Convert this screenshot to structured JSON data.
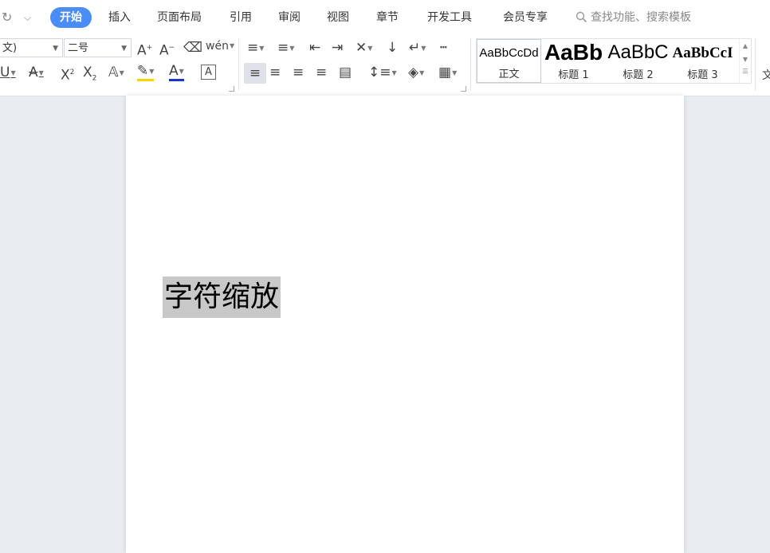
{
  "menubar": {
    "tabs": [
      {
        "label": "开始",
        "active": true
      },
      {
        "label": "插入"
      },
      {
        "label": "页面布局"
      },
      {
        "label": "引用"
      },
      {
        "label": "审阅"
      },
      {
        "label": "视图"
      },
      {
        "label": "章节"
      },
      {
        "label": "开发工具"
      },
      {
        "label": "会员专享"
      }
    ],
    "search_label": "查找功能、搜索模板"
  },
  "ribbon": {
    "font_name": "文)",
    "font_size": "二号",
    "styles": [
      {
        "sample": "AaBbCcDd",
        "label": "正文"
      },
      {
        "sample": "AaBb",
        "label": "标题 1"
      },
      {
        "sample": "AaBbC",
        "label": "标题 2"
      },
      {
        "sample": "AaBbCcI",
        "label": "标题 3"
      }
    ],
    "edge_glyph": "文"
  },
  "document": {
    "selected_text": "字符缩放"
  },
  "colors": {
    "accent": "#4a8df8",
    "selection": "#c8c8c8",
    "highlight": "#f5d800",
    "font_color": "#1a33cc"
  }
}
